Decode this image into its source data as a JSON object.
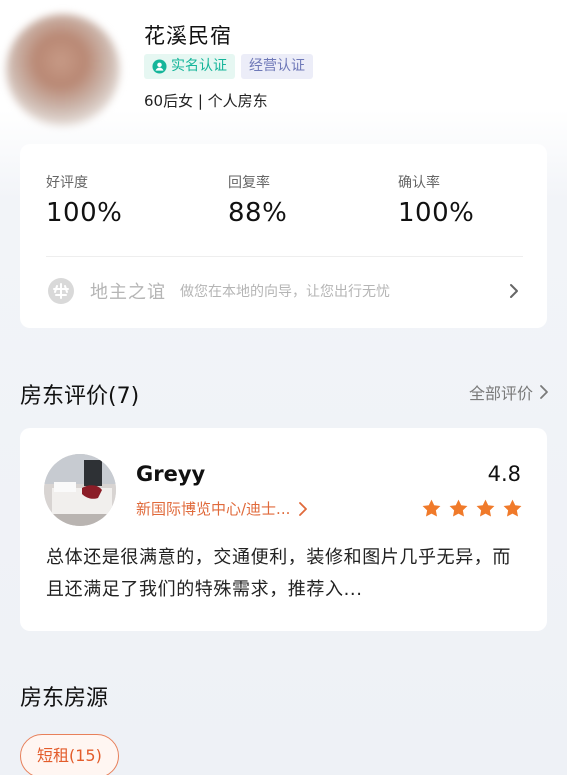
{
  "host": {
    "name": "花溪民宿",
    "badges": {
      "real_name": "实名认证",
      "business": "经营认证"
    },
    "profile": "60后女 | 个人房东"
  },
  "stats": [
    {
      "label": "好评度",
      "value": "100%"
    },
    {
      "label": "回复率",
      "value": "88%"
    },
    {
      "label": "确认率",
      "value": "100%"
    }
  ],
  "program": {
    "icon": "landlord-badge-icon",
    "name": "地主之谊",
    "description": "做您在本地的向导，让您出行无忧"
  },
  "reviews_section": {
    "title": "房东评价(7)",
    "see_all": "全部评价"
  },
  "review": {
    "author": "Greyy",
    "location": "新国际博览中心/迪士...",
    "score": "4.8",
    "stars": 4,
    "text": "总体还是很满意的，交通便利，装修和图片几乎无异，而且还满足了我们的特殊需求，推荐入..."
  },
  "listings_section": {
    "title": "房东房源",
    "filter_chip": "短租(15)"
  },
  "colors": {
    "accent_orange": "#e35c2b",
    "star_orange": "#f07a2a",
    "verified_green": "#15b59a",
    "business_purple": "#6f79b8"
  }
}
